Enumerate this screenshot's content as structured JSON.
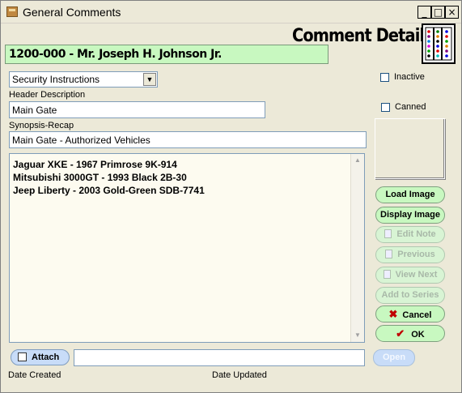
{
  "window": {
    "title": "General Comments",
    "controls": {
      "minimize": "_",
      "maximize": "□",
      "close": "×"
    }
  },
  "header": {
    "title": "Comment Detail",
    "record": "1200-000 - Mr. Joseph H. Johnson Jr."
  },
  "form": {
    "category": {
      "selected": "Security Instructions"
    },
    "header_description": {
      "label": "Header Description",
      "value": "Main Gate"
    },
    "synopsis": {
      "label": "Synopsis-Recap",
      "value": "Main Gate - Authorized Vehicles"
    },
    "inactive": {
      "label": "Inactive",
      "checked": false
    },
    "canned": {
      "label": "Canned",
      "checked": false
    },
    "comment_lines": [
      "Jaguar XKE - 1967 Primrose 9K-914",
      "Mitsubishi 3000GT - 1993 Black 2B-30",
      "Jeep Liberty - 2003 Gold-Green SDB-7741"
    ],
    "attach_path": ""
  },
  "buttons": {
    "load_image": "Load Image",
    "display_image": "Display Image",
    "edit_note": "Edit Note",
    "previous": "Previous",
    "view_next": "View Next",
    "add_to_series": "Add to Series",
    "cancel": "Cancel",
    "ok": "OK",
    "attach": "Attach",
    "open": "Open"
  },
  "footer": {
    "date_created": "Date Created",
    "date_updated": "Date Updated"
  },
  "icons": {
    "cancel": "x-mark-icon",
    "ok": "checkmark-icon",
    "edit": "document-icon",
    "attach": "paperclip-document-icon"
  },
  "colors": {
    "pill_green": "#c8f8c0",
    "banner_green": "#c8f8c0",
    "pill_blue": "#c8dcf8",
    "memo_bg": "#fdfbf0",
    "cancel_x": "#c00000"
  }
}
